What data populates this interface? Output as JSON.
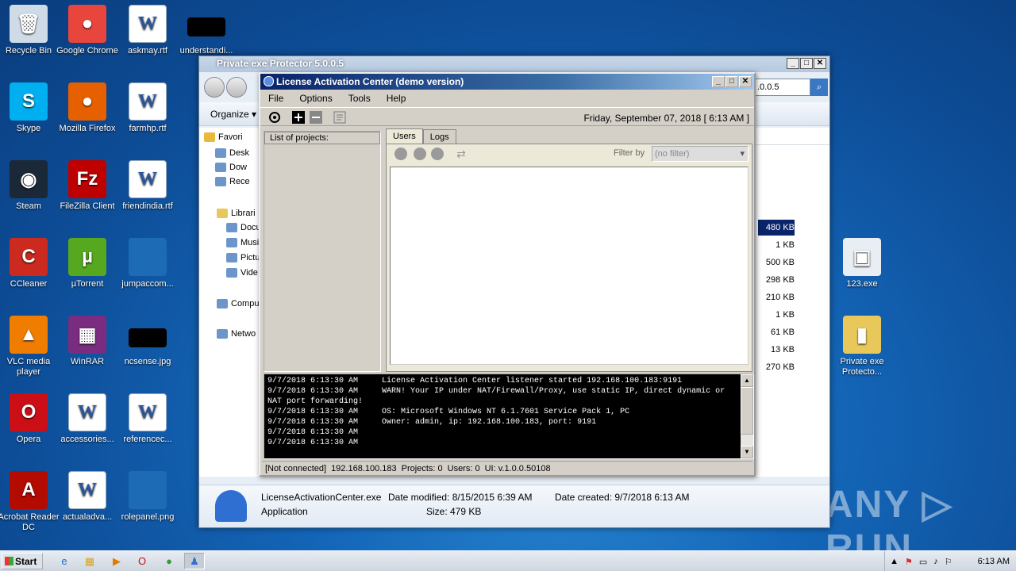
{
  "desktop": {
    "icons": [
      {
        "label": "Recycle Bin",
        "glyph": "🗑",
        "color": "#d0dbe8"
      },
      {
        "label": "Google Chrome",
        "glyph": "●",
        "color": "#e8453c"
      },
      {
        "label": "askmay.rtf",
        "glyph": "W",
        "color": "doc"
      },
      {
        "label": "understandi...",
        "glyph": "",
        "color": "black"
      },
      {
        "label": "Skype",
        "glyph": "S",
        "color": "#00aff0"
      },
      {
        "label": "Mozilla Firefox",
        "glyph": "●",
        "color": "#e66000"
      },
      {
        "label": "farmhp.rtf",
        "glyph": "W",
        "color": "doc"
      },
      {
        "label": "Steam",
        "glyph": "◉",
        "color": "#1b2838"
      },
      {
        "label": "FileZilla Client",
        "glyph": "Fz",
        "color": "#bf0000"
      },
      {
        "label": "friendindia.rtf",
        "glyph": "W",
        "color": "doc"
      },
      {
        "label": "CCleaner",
        "glyph": "C",
        "color": "#cc2a1e"
      },
      {
        "label": "µTorrent",
        "glyph": "µ",
        "color": "#56a820"
      },
      {
        "label": "jumpaccom...",
        "glyph": "",
        "color": "#1c6bb4"
      },
      {
        "label": "VLC media player",
        "glyph": "▲",
        "color": "#f07d00"
      },
      {
        "label": "WinRAR",
        "glyph": "▦",
        "color": "#7a2c80"
      },
      {
        "label": "ncsense.jpg",
        "glyph": "",
        "color": "black"
      },
      {
        "label": "Opera",
        "glyph": "O",
        "color": "#cc0f16"
      },
      {
        "label": "accessories...",
        "glyph": "W",
        "color": "doc"
      },
      {
        "label": "referencec...",
        "glyph": "W",
        "color": "doc"
      },
      {
        "label": "Acrobat Reader DC",
        "glyph": "A",
        "color": "#b30b00"
      },
      {
        "label": "actualadva...",
        "glyph": "W",
        "color": "doc"
      },
      {
        "label": "rolepanel.png",
        "glyph": "",
        "color": "#1c6bb4"
      },
      {
        "label": "123.exe",
        "glyph": "▣",
        "color": "#e8eef4"
      },
      {
        "label": "Private exe Protecto...",
        "glyph": "▮",
        "color": "#e8c85a"
      }
    ],
    "watermark": "ANY ▷ RUN"
  },
  "explorer": {
    "title": "Private exe Protector 5.0.0.5",
    "address_fragment": ".0.0.5",
    "organize_label": "Organize ▾",
    "nav_items": [
      "Favori",
      "Desk",
      "Dow",
      "Rece",
      "Librari",
      "Docu",
      "Musi",
      "Pictu",
      "Vide",
      "Compu",
      "Netwo"
    ],
    "file_sizes": [
      "480 KB",
      "1 KB",
      "500 KB",
      "298 KB",
      "210 KB",
      "1 KB",
      "61 KB",
      "13 KB",
      "270 KB"
    ],
    "details": {
      "name": "LicenseActivationCenter.exe",
      "type": "Application",
      "modified_label": "Date modified: 8/15/2015 6:39 AM",
      "created_label": "Date created: 9/7/2018 6:13 AM",
      "size_label": "Size: 479 KB"
    }
  },
  "lac": {
    "title": "License Activation Center (demo version)",
    "menu": [
      "File",
      "Options",
      "Tools",
      "Help"
    ],
    "datetime": "Friday, September 07, 2018  [ 6:13 AM ]",
    "projects_header": "List of projects:",
    "tabs": [
      "Users",
      "Logs"
    ],
    "filter_label": "Filter by",
    "filter_value": "(no filter)",
    "log_lines": [
      "9/7/2018 6:13:30 AM     License Activation Center listener started 192.168.100.183:9191",
      "9/7/2018 6:13:30 AM     WARN! Your IP under NAT/Firewall/Proxy, use static IP, direct dynamic or",
      "NAT port forwarding!",
      "9/7/2018 6:13:30 AM     OS: Microsoft Windows NT 6.1.7601 Service Pack 1, PC",
      "9/7/2018 6:13:30 AM     Owner: admin, ip: 192.168.100.183, port: 9191",
      "9/7/2018 6:13:30 AM",
      "9/7/2018 6:13:30 AM"
    ],
    "status": {
      "connection": "[Not connected]",
      "ip": "192.168.100.183",
      "projects": "Projects: 0",
      "users": "Users: 0",
      "ui": "UI: v.1.0.0.50108"
    }
  },
  "taskbar": {
    "start_label": "Start",
    "clock": "6:13 AM"
  }
}
